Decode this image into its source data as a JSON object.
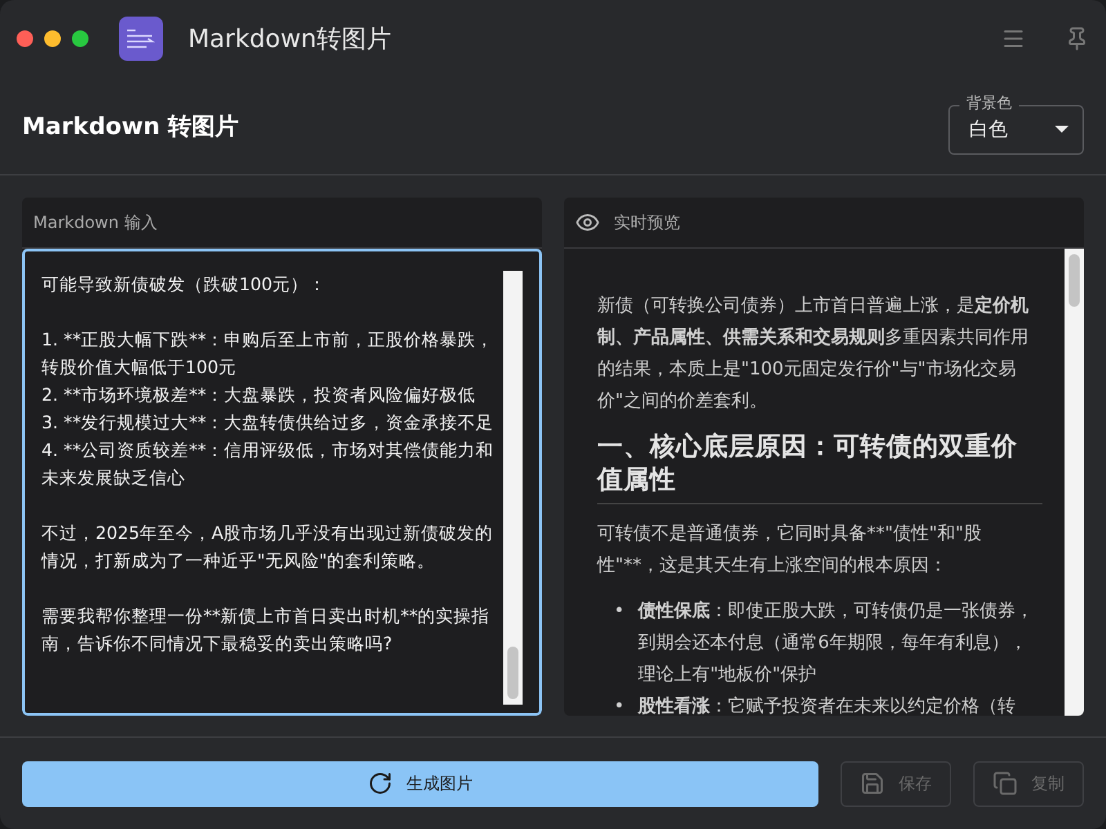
{
  "window": {
    "title": "Markdown转图片"
  },
  "header": {
    "title": "Markdown 转图片",
    "background_select": {
      "label": "背景色",
      "value": "白色"
    }
  },
  "input_panel": {
    "title": "Markdown 输入",
    "paragraphs": [
      [
        "可能导致新债破发（跌破100元）："
      ],
      [
        "1. **正股大幅下跌**：申购后至上市前，正股价格暴跌，转股价值大幅低于100元",
        "2. **市场环境极差**：大盘暴跌，投资者风险偏好极低",
        "3. **发行规模过大**：大盘转债供给过多，资金承接不足",
        "4. **公司资质较差**：信用评级低，市场对其偿债能力和未来发展缺乏信心"
      ],
      [
        "不过，2025年至今，A股市场几乎没有出现过新债破发的情况，打新成为了一种近乎\"无风险\"的套利策略。"
      ],
      [
        "需要我帮你整理一份**新债上市首日卖出时机**的实操指南，告诉你不同情况下最稳妥的卖出策略吗?"
      ]
    ]
  },
  "preview_panel": {
    "title": "实时预览",
    "blocks": [
      {
        "kind": "paragraph",
        "segments": [
          {
            "text": "新债（可转换公司债券）上市首日普遍上涨，是",
            "bold": false
          },
          {
            "text": "定价机制、产品属性、供需关系和交易规则",
            "bold": true
          },
          {
            "text": "多重因素共同作用的结果，本质上是\"100元固定发行价\"与\"市场化交易价\"之间的价差套利。",
            "bold": false
          }
        ]
      },
      {
        "kind": "heading",
        "segments": [
          {
            "text": "一、核心底层原因：可转债的双重价值属性",
            "bold": true
          }
        ]
      },
      {
        "kind": "paragraph",
        "segments": [
          {
            "text": "可转债不是普通债券，它同时具备**\"债性\"和\"股性\"**，这是其天生有上涨空间的根本原因：",
            "bold": false
          }
        ]
      },
      {
        "kind": "bullet",
        "marker": "•",
        "segments": [
          {
            "text": "债性保底",
            "bold": true
          },
          {
            "text": "：即使正股大跌，可转债仍是一张债券，到期会还本付息（通常6年期限，每年有利息），理论上有\"地板价\"保护",
            "bold": false
          }
        ]
      },
      {
        "kind": "bullet",
        "marker": "•",
        "segments": [
          {
            "text": "股性看涨",
            "bold": true
          },
          {
            "text": "：它赋予投资者在未来以约定价格（转",
            "bold": false
          }
        ]
      }
    ]
  },
  "actions": [
    {
      "kind": "primary",
      "label": "生成图片",
      "disabled": false
    },
    {
      "kind": "save",
      "label": "保存",
      "disabled": true
    },
    {
      "kind": "copy",
      "label": "复制",
      "disabled": true
    }
  ]
}
